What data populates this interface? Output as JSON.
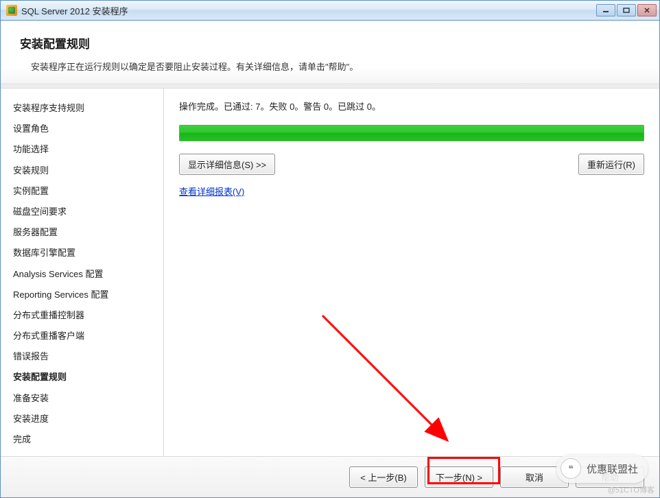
{
  "window": {
    "title": "SQL Server 2012 安装程序"
  },
  "header": {
    "title": "安装配置规则",
    "subtitle": "安装程序正在运行规则以确定是否要阻止安装过程。有关详细信息，请单击\"帮助\"。"
  },
  "sidebar": {
    "items": [
      "安装程序支持规则",
      "设置角色",
      "功能选择",
      "安装规则",
      "实例配置",
      "磁盘空间要求",
      "服务器配置",
      "数据库引擎配置",
      "Analysis Services 配置",
      "Reporting Services 配置",
      "分布式重播控制器",
      "分布式重播客户端",
      "错误报告",
      "安装配置规则",
      "准备安装",
      "安装进度",
      "完成"
    ],
    "active_index": 13
  },
  "content": {
    "status_text": "操作完成。已通过: 7。失败 0。警告 0。已跳过 0。",
    "show_details_label": "显示详细信息(S) >>",
    "rerun_label": "重新运行(R)",
    "report_link": "查看详细报表(V)"
  },
  "footer": {
    "back_label": "< 上一步(B)",
    "next_label": "下一步(N) >",
    "cancel_label": "取消",
    "help_label": "帮助"
  },
  "watermark": {
    "text": "优惠联盟社",
    "small": "@51CTO博客"
  }
}
